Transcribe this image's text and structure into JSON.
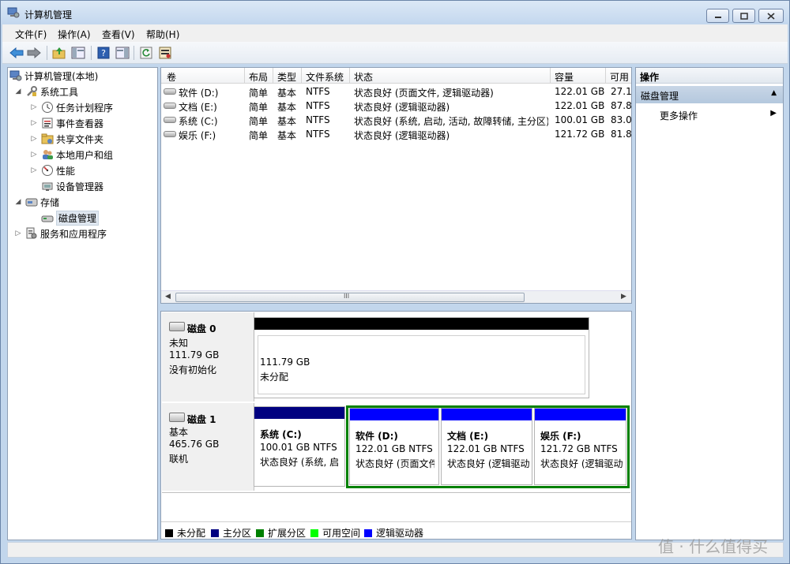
{
  "window": {
    "title": "计算机管理"
  },
  "menu": [
    "文件(F)",
    "操作(A)",
    "查看(V)",
    "帮助(H)"
  ],
  "tree": {
    "root": "计算机管理(本地)",
    "system_tools": "系统工具",
    "task_scheduler": "任务计划程序",
    "event_viewer": "事件查看器",
    "shared_folders": "共享文件夹",
    "local_users": "本地用户和组",
    "performance": "性能",
    "device_manager": "设备管理器",
    "storage": "存储",
    "disk_management": "磁盘管理",
    "services": "服务和应用程序"
  },
  "volume_list": {
    "headers": [
      "卷",
      "布局",
      "类型",
      "文件系统",
      "状态",
      "容量",
      "可用"
    ],
    "rows": [
      {
        "volume": "软件 (D:)",
        "layout": "简单",
        "type": "基本",
        "fs": "NTFS",
        "status": "状态良好 (页面文件, 逻辑驱动器)",
        "capacity": "122.01 GB",
        "free": "27.1"
      },
      {
        "volume": "文档 (E:)",
        "layout": "简单",
        "type": "基本",
        "fs": "NTFS",
        "status": "状态良好 (逻辑驱动器)",
        "capacity": "122.01 GB",
        "free": "87.8"
      },
      {
        "volume": "系统 (C:)",
        "layout": "简单",
        "type": "基本",
        "fs": "NTFS",
        "status": "状态良好 (系统, 启动, 活动, 故障转储, 主分区)",
        "capacity": "100.01 GB",
        "free": "83.0"
      },
      {
        "volume": "娱乐 (F:)",
        "layout": "简单",
        "type": "基本",
        "fs": "NTFS",
        "status": "状态良好 (逻辑驱动器)",
        "capacity": "121.72 GB",
        "free": "81.8"
      }
    ],
    "scroll_glyph": "III"
  },
  "disks": [
    {
      "name": "磁盘 0",
      "kind": "未知",
      "size": "111.79 GB",
      "state": "没有初始化",
      "partitions": [
        {
          "title": "",
          "size": "111.79 GB",
          "status": "未分配",
          "color": "#000000"
        }
      ]
    },
    {
      "name": "磁盘 1",
      "kind": "基本",
      "size": "465.76 GB",
      "state": "联机",
      "partitions": [
        {
          "title": "系统  (C:)",
          "size": "100.01 GB NTFS",
          "status": "状态良好 (系统, 启",
          "color": "#000080"
        },
        {
          "title": "软件  (D:)",
          "size": "122.01 GB NTFS",
          "status": "状态良好 (页面文件",
          "color": "#0000ff"
        },
        {
          "title": "文档  (E:)",
          "size": "122.01 GB NTFS",
          "status": "状态良好 (逻辑驱动",
          "color": "#0000ff"
        },
        {
          "title": "娱乐  (F:)",
          "size": "121.72 GB NTFS",
          "status": "状态良好 (逻辑驱动",
          "color": "#0000ff"
        }
      ]
    }
  ],
  "legend": [
    {
      "label": "未分配",
      "color": "#000000"
    },
    {
      "label": "主分区",
      "color": "#000080"
    },
    {
      "label": "扩展分区",
      "color": "#008000"
    },
    {
      "label": "可用空间",
      "color": "#00ff00"
    },
    {
      "label": "逻辑驱动器",
      "color": "#0000ff"
    }
  ],
  "actions": {
    "header": "操作",
    "group": "磁盘管理",
    "more": "更多操作"
  },
  "watermark": "值 · 什么值得买"
}
